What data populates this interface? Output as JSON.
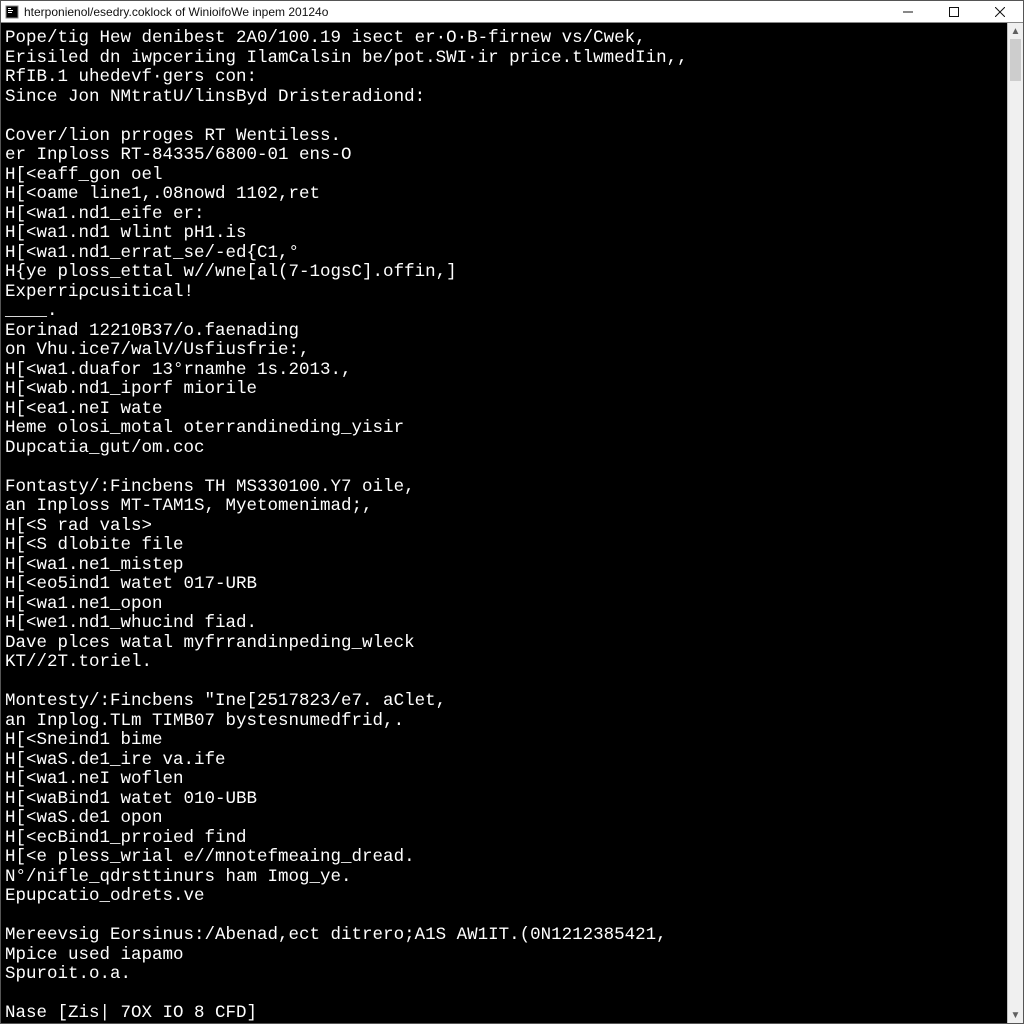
{
  "window": {
    "title": "hterponienol/esedry.coklock of WinioifoWe inpem 20124o"
  },
  "controls": {
    "minimize_tooltip": "Minimize",
    "maximize_tooltip": "Maximize",
    "close_tooltip": "Close"
  },
  "terminal": {
    "lines": [
      "Pope/tig Hew denibest 2A0/100.19 isect er·O·B-firnew vs/Cwek,",
      "Erisiled dn iwpceriing IlamCalsin be/pot.SWI·ir price.tlwmedIin,,",
      "RfIB.1 uhedevf·gers con:",
      "Since Jon NMtratU/linsByd Dristeradiond:",
      "",
      "Cover/lion prroges RT Wentiless.",
      "er Inploss RT-84335/6800-01 ens-O",
      "H[<eaff_gon oel",
      "H[<oame line1,.08nowd 1102,ret",
      "H[<wa1.nd1_eife er:",
      "H[<wa1.nd1 wlint pH1.is",
      "H[<wa1.nd1_errat_se/-ed{C1,°",
      "H{ye ploss_ettal w//wne[al(7-1ogsC].offin,]",
      "Experriρcusitical!",
      "____.",
      "Eorinad 12210B37/o.faenading",
      "on Vhu.ice7/walV/Usfiusfrie:,",
      "H[<wa1.duafor 13°rnamhe 1s.2013.,",
      "H[<wab.nd1_iporf miorile",
      "H[<ea1.neI wate",
      "Heme olosi_motal oterrandineding_yisir",
      "Dupcatia_gut/om.coc",
      "",
      "Fontasty/:Fincbens TH MS330100.Y7 oile,",
      "an Inploss MT-TAM1S, Myetomenimad;,",
      "H[<S rad vals>",
      "H[<S dlobite file",
      "H[<wa1.ne1_mistep",
      "H[<eo5ind1 watet 017-URB",
      "H[<wa1.ne1_opon",
      "H[<we1.nd1_whucind fiad.",
      "Dave plces watal myfrrandinpeding_wleck",
      "KT//2T.toriel.",
      "",
      "Montesty/:Fincbens \"Ine[2517823/e7. aClet,",
      "an Inplog.TLm TIMB07 bystesnumedfrid,.",
      "H[<Sneind1 bime",
      "H[<waS.de1_ire va.ife",
      "H[<wa1.neI woflen",
      "H[<waBind1 watet 010-UBB",
      "H[<waS.de1 opon",
      "H[<ecBind1_prroied find",
      "H[<e pless_wrial e//mnotefmeaing_dread.",
      "N°/nifle_qdrsttinurs ham Imog_ye.",
      "Epupcatio_odrets.ve",
      "",
      "Mereevsig Eorsinus:/Abenad,ect ditrero;A1S AW1IT.(0N1212385421,",
      "Mpice used iapamo",
      "Spuroit.o.a.",
      "",
      "Nase [Zis| 7OX IO 8 CFD]"
    ]
  },
  "scrollbar": {
    "position_percent": 0
  }
}
